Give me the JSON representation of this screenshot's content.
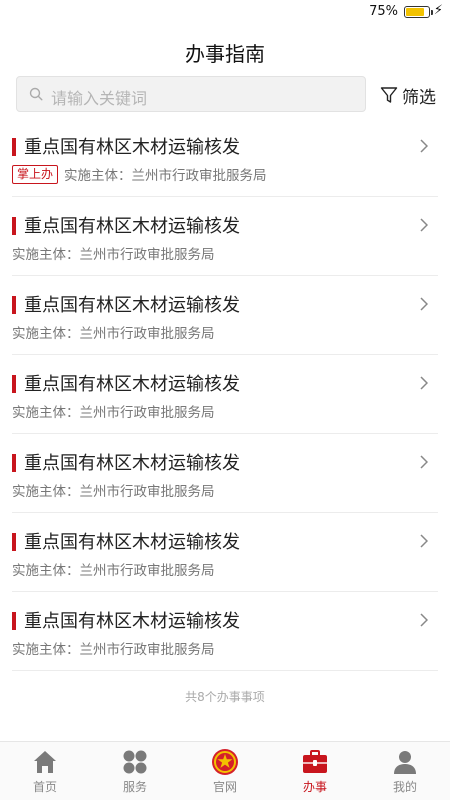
{
  "status_bar": {
    "battery_percent": "75%"
  },
  "header": {
    "title": "办事指南"
  },
  "search": {
    "placeholder": "请输入关键词"
  },
  "filter": {
    "label": "筛选"
  },
  "items": [
    {
      "title": "重点国有林区木材运输核发",
      "badge": "掌上办",
      "subtitle": "实施主体：兰州市行政审批服务局"
    },
    {
      "title": "重点国有林区木材运输核发",
      "subtitle": "实施主体：兰州市行政审批服务局"
    },
    {
      "title": "重点国有林区木材运输核发",
      "subtitle": "实施主体：兰州市行政审批服务局"
    },
    {
      "title": "重点国有林区木材运输核发",
      "subtitle": "实施主体：兰州市行政审批服务局"
    },
    {
      "title": "重点国有林区木材运输核发",
      "subtitle": "实施主体：兰州市行政审批服务局"
    },
    {
      "title": "重点国有林区木材运输核发",
      "subtitle": "实施主体：兰州市行政审批服务局"
    },
    {
      "title": "重点国有林区木材运输核发",
      "subtitle": "实施主体：兰州市行政审批服务局"
    }
  ],
  "footer": {
    "count_text": "共8个办事事项"
  },
  "colors": {
    "accent": "#c8151d"
  },
  "nav": [
    {
      "label": "首页",
      "icon": "home-icon"
    },
    {
      "label": "服务",
      "icon": "services-icon"
    },
    {
      "label": "官网",
      "icon": "emblem-icon"
    },
    {
      "label": "办事",
      "icon": "briefcase-icon",
      "active": true
    },
    {
      "label": "我的",
      "icon": "user-icon"
    }
  ]
}
